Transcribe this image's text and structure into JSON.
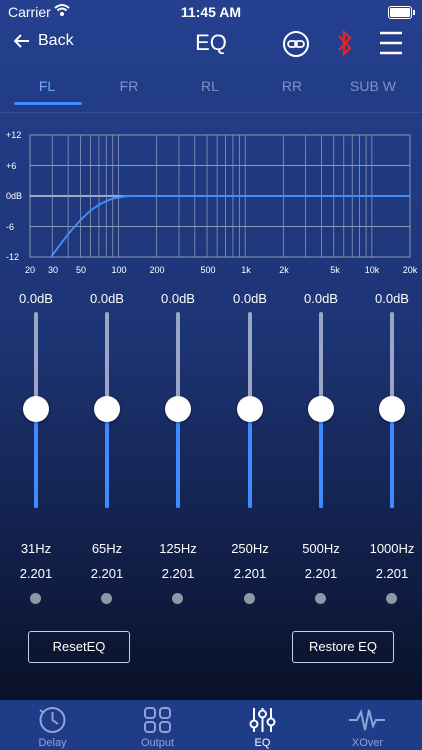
{
  "status_bar": {
    "carrier": "Carrier",
    "time": "11:45 AM"
  },
  "nav": {
    "back_label": "Back",
    "title": "EQ"
  },
  "tabs": [
    {
      "label": "FL",
      "active": true
    },
    {
      "label": "FR",
      "active": false
    },
    {
      "label": "RL",
      "active": false
    },
    {
      "label": "RR",
      "active": false
    },
    {
      "label": "SUB W",
      "active": false
    }
  ],
  "graph": {
    "y_ticks": [
      "+12",
      "+6",
      "0dB",
      "-6",
      "-12"
    ],
    "x_ticks": [
      "20",
      "30",
      "50",
      "100",
      "200",
      "500",
      "1k",
      "2k",
      "5k",
      "10k",
      "20k"
    ]
  },
  "bands": [
    {
      "gain": "0.0dB",
      "freq": "31Hz",
      "q": "2.201",
      "level": 0.5
    },
    {
      "gain": "0.0dB",
      "freq": "65Hz",
      "q": "2.201",
      "level": 0.5
    },
    {
      "gain": "0.0dB",
      "freq": "125Hz",
      "q": "2.201",
      "level": 0.5
    },
    {
      "gain": "0.0dB",
      "freq": "250Hz",
      "q": "2.201",
      "level": 0.5
    },
    {
      "gain": "0.0dB",
      "freq": "500Hz",
      "q": "2.201",
      "level": 0.5
    },
    {
      "gain": "0.0dB",
      "freq": "1000Hz",
      "q": "2.201",
      "level": 0.5
    }
  ],
  "buttons": {
    "reset": "ResetEQ",
    "restore": "Restore EQ"
  },
  "bottom_nav": [
    {
      "label": "Delay",
      "icon": "clock-icon",
      "active": false
    },
    {
      "label": "Output",
      "icon": "grid-icon",
      "active": false
    },
    {
      "label": "EQ",
      "icon": "sliders-icon",
      "active": true
    },
    {
      "label": "XOver",
      "icon": "waveform-icon",
      "active": false
    }
  ],
  "colors": {
    "accent": "#3f8cff",
    "bluetooth": "#e8222a",
    "tab_bar": "#1e3c88"
  }
}
